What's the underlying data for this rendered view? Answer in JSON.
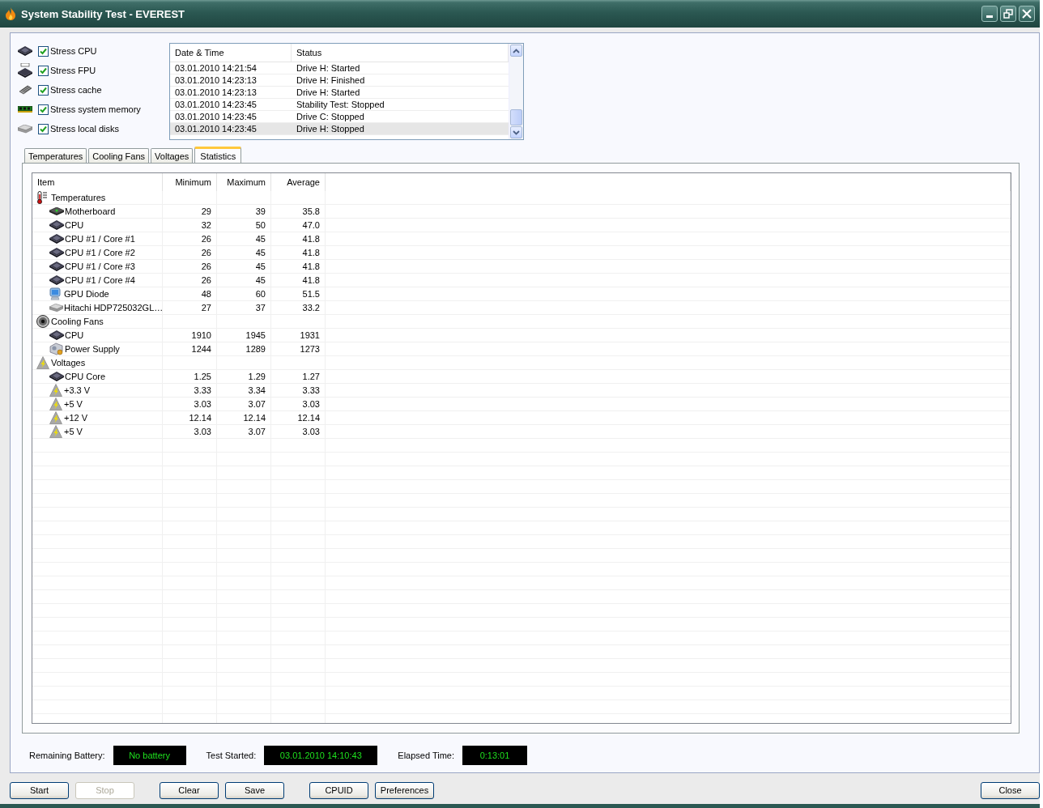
{
  "window": {
    "title": "System Stability Test - EVEREST"
  },
  "stress_options": [
    {
      "label": "Stress CPU",
      "kind": "cpu",
      "checked": true
    },
    {
      "label": "Stress FPU",
      "kind": "fpu",
      "checked": true
    },
    {
      "label": "Stress cache",
      "kind": "cache",
      "checked": true
    },
    {
      "label": "Stress system memory",
      "kind": "memory",
      "checked": true
    },
    {
      "label": "Stress local disks",
      "kind": "disk",
      "checked": true
    }
  ],
  "log": {
    "columns": [
      "Date & Time",
      "Status"
    ],
    "rows": [
      {
        "time": "03.01.2010 14:21:54",
        "status": "Drive H: Started",
        "selected": false
      },
      {
        "time": "03.01.2010 14:23:13",
        "status": "Drive H: Finished",
        "selected": false
      },
      {
        "time": "03.01.2010 14:23:13",
        "status": "Drive H: Started",
        "selected": false
      },
      {
        "time": "03.01.2010 14:23:45",
        "status": "Stability Test: Stopped",
        "selected": false
      },
      {
        "time": "03.01.2010 14:23:45",
        "status": "Drive C: Stopped",
        "selected": false
      },
      {
        "time": "03.01.2010 14:23:45",
        "status": "Drive H: Stopped",
        "selected": true
      }
    ]
  },
  "tabs": [
    {
      "label": "Temperatures",
      "selected": false
    },
    {
      "label": "Cooling Fans",
      "selected": false
    },
    {
      "label": "Voltages",
      "selected": false
    },
    {
      "label": "Statistics",
      "selected": true
    }
  ],
  "table": {
    "columns": [
      "Item",
      "Minimum",
      "Maximum",
      "Average"
    ],
    "groups": [
      {
        "label": "Temperatures",
        "kind": "thermometer",
        "children": [
          {
            "label": "Motherboard",
            "kind": "motherboard",
            "minimum": "29",
            "maximum": "39",
            "average": "35.8"
          },
          {
            "label": "CPU",
            "kind": "cpu",
            "minimum": "32",
            "maximum": "50",
            "average": "47.0"
          },
          {
            "label": "CPU #1 / Core #1",
            "kind": "cpu",
            "minimum": "26",
            "maximum": "45",
            "average": "41.8"
          },
          {
            "label": "CPU #1 / Core #2",
            "kind": "cpu",
            "minimum": "26",
            "maximum": "45",
            "average": "41.8"
          },
          {
            "label": "CPU #1 / Core #3",
            "kind": "cpu",
            "minimum": "26",
            "maximum": "45",
            "average": "41.8"
          },
          {
            "label": "CPU #1 / Core #4",
            "kind": "cpu",
            "minimum": "26",
            "maximum": "45",
            "average": "41.8"
          },
          {
            "label": "GPU Diode",
            "kind": "gpu",
            "minimum": "48",
            "maximum": "60",
            "average": "51.5"
          },
          {
            "label": "Hitachi HDP725032GL…",
            "kind": "disk",
            "minimum": "27",
            "maximum": "37",
            "average": "33.2"
          }
        ]
      },
      {
        "label": "Cooling Fans",
        "kind": "fan",
        "children": [
          {
            "label": "CPU",
            "kind": "cpu",
            "minimum": "1910",
            "maximum": "1945",
            "average": "1931"
          },
          {
            "label": "Power Supply",
            "kind": "psu",
            "minimum": "1244",
            "maximum": "1289",
            "average": "1273"
          }
        ]
      },
      {
        "label": "Voltages",
        "kind": "voltage",
        "children": [
          {
            "label": "CPU Core",
            "kind": "cpu",
            "minimum": "1.25",
            "maximum": "1.29",
            "average": "1.27"
          },
          {
            "label": "+3.3 V",
            "kind": "voltage",
            "minimum": "3.33",
            "maximum": "3.34",
            "average": "3.33"
          },
          {
            "label": "+5 V",
            "kind": "voltage",
            "minimum": "3.03",
            "maximum": "3.07",
            "average": "3.03"
          },
          {
            "label": "+12 V",
            "kind": "voltage",
            "minimum": "12.14",
            "maximum": "12.14",
            "average": "12.14"
          },
          {
            "label": "+5 V",
            "kind": "voltage",
            "minimum": "3.03",
            "maximum": "3.07",
            "average": "3.03"
          }
        ]
      }
    ]
  },
  "status": [
    {
      "label": "Remaining Battery:",
      "value": "No battery"
    },
    {
      "label": "Test Started:",
      "value": "03.01.2010 14:10:43"
    },
    {
      "label": "Elapsed Time:",
      "value": "0:13:01"
    }
  ],
  "buttons": [
    {
      "label": "Start",
      "disabled": false
    },
    {
      "label": "Stop",
      "disabled": true
    },
    {
      "label": "Clear",
      "disabled": false
    },
    {
      "label": "Save",
      "disabled": false
    },
    {
      "label": "CPUID",
      "disabled": false
    },
    {
      "label": "Preferences",
      "disabled": false
    },
    {
      "label": "Close",
      "disabled": false
    }
  ]
}
